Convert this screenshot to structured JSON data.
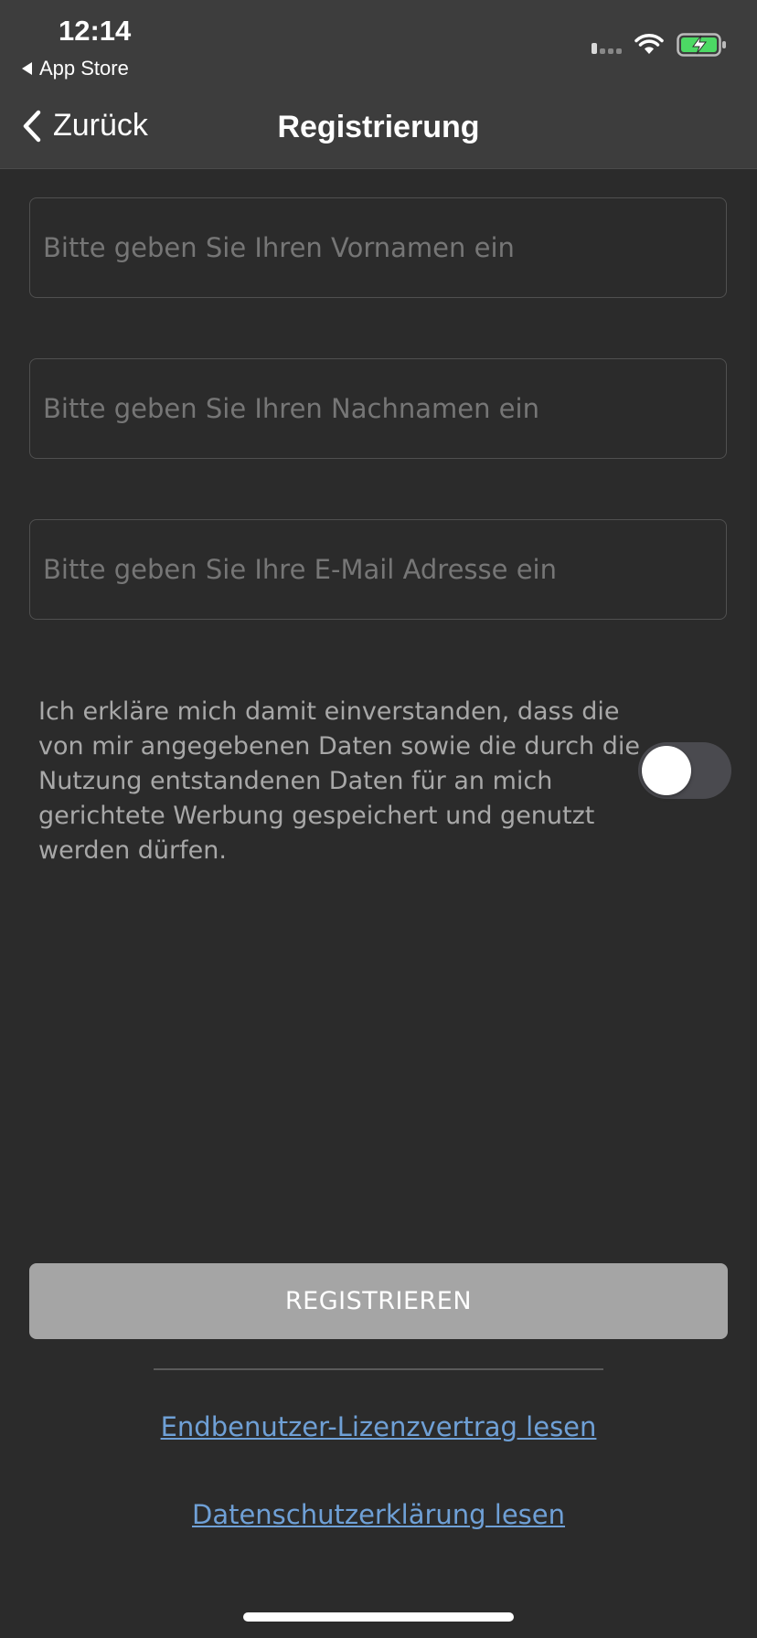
{
  "status_bar": {
    "time": "12:14",
    "back_app_label": "App Store"
  },
  "nav": {
    "back_label": "Zurück",
    "title": "Registrierung"
  },
  "form": {
    "first_name_placeholder": "Bitte geben Sie Ihren Vornamen ein",
    "last_name_placeholder": "Bitte geben Sie Ihren Nachnamen ein",
    "email_placeholder": "Bitte geben Sie Ihre E-Mail Adresse ein",
    "first_name_value": "",
    "last_name_value": "",
    "email_value": ""
  },
  "consent": {
    "text": "Ich erkläre mich damit einverstanden, dass die von mir angegebenen Daten sowie die durch die Nutzung entstandenen Daten für an mich gerichtete Werbung gespeichert und genutzt werden dürfen.",
    "toggle_on": false
  },
  "actions": {
    "register_label": "REGISTRIEREN",
    "eula_link": "Endbenutzer-Lizenzvertrag lesen",
    "privacy_link": "Datenschutzerklärung lesen"
  },
  "colors": {
    "background": "#2b2b2b",
    "header": "#3d3d3d",
    "battery_green": "#4cd964",
    "link": "#6fa0d6",
    "button": "#a5a5a5"
  }
}
